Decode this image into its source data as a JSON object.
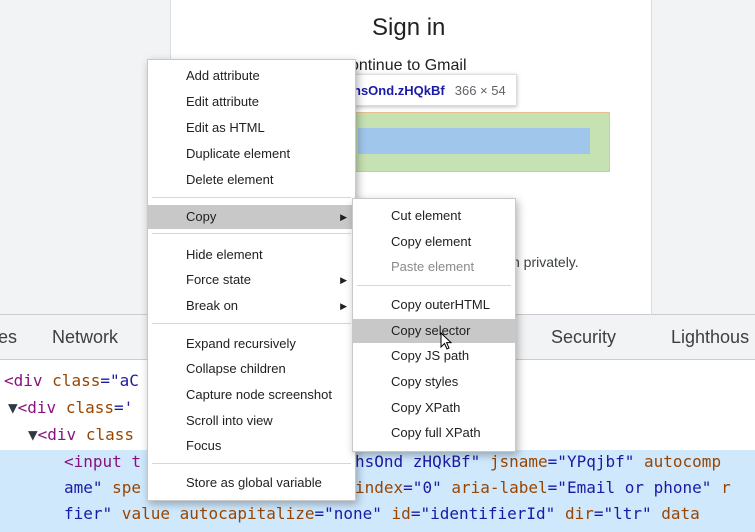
{
  "page": {
    "title": "Sign in",
    "subtitle": "ontinue to Gmail",
    "privately": "n privately.",
    "tooltip": {
      "class_text": "hsOnd.zHQkBf",
      "size_text": "366 × 54"
    }
  },
  "devtools": {
    "tabs": {
      "left": "es",
      "network": "Network",
      "security": "Security",
      "lighthouse": "Lighthous"
    },
    "code": {
      "l1_tag": "<div ",
      "l1_attr": "class",
      "l1_eq": "=\"aC",
      "l2_tag": "<div ",
      "l2_attr": "class",
      "l2_eq": "='",
      "l3_tag": "<div ",
      "l3_attr": "class",
      "l4_tag": "<input t",
      "l4_rest_val": "hsOnd zHQkBf\"",
      "l4_attr2": " jsname",
      "l4_val2": "=\"YPqjbf\"",
      "l4_attr3": " autocomp",
      "l5_start": "ame\"",
      "l5_attr": " spe",
      "l5_mid": "index",
      "l5_val": "=\"0\"",
      "l5_attr2": " aria-label",
      "l5_val2": "=\"Email or phone\"",
      "l5_end": " r",
      "l6_start": "fier\"",
      "l6_attr": " value",
      "l6_attr2": " autocapitalize",
      "l6_val2": "=\"none\"",
      "l6_attr3": " id",
      "l6_val3": "=\"identifierId\"",
      "l6_attr4": " dir",
      "l6_val4": "=\"ltr\"",
      "l6_attr5": " data"
    }
  },
  "context_menu": {
    "items": {
      "add_attribute": "Add attribute",
      "edit_attribute": "Edit attribute",
      "edit_as_html": "Edit as HTML",
      "duplicate_element": "Duplicate element",
      "delete_element": "Delete element",
      "copy": "Copy",
      "hide_element": "Hide element",
      "force_state": "Force state",
      "break_on": "Break on",
      "expand_recursively": "Expand recursively",
      "collapse_children": "Collapse children",
      "capture_node_screenshot": "Capture node screenshot",
      "scroll_into_view": "Scroll into view",
      "focus": "Focus",
      "store_as_global_variable": "Store as global variable"
    }
  },
  "copy_submenu": {
    "items": {
      "cut_element": "Cut element",
      "copy_element": "Copy element",
      "paste_element": "Paste element",
      "copy_outer_html": "Copy outerHTML",
      "copy_selector": "Copy selector",
      "copy_js_path": "Copy JS path",
      "copy_styles": "Copy styles",
      "copy_xpath": "Copy XPath",
      "copy_full_xpath": "Copy full XPath"
    }
  },
  "colors": {
    "highlight_outer": "#c6e2b3",
    "highlight_inner": "#a0c6eb",
    "selected_row": "#cfe8fc",
    "menu_active": "#c8c8c8"
  }
}
